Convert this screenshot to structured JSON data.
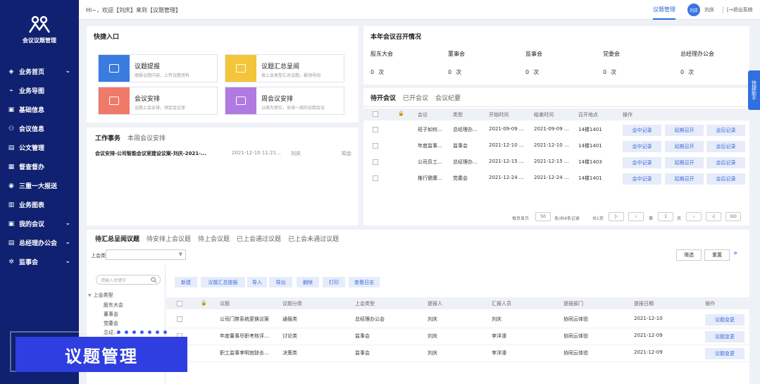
{
  "app": {
    "name": "会议议题管理"
  },
  "sidebar": {
    "items": [
      {
        "label": "业务首页",
        "icon": "home-icon",
        "chev": true
      },
      {
        "label": "业务导图",
        "icon": "map-icon",
        "chev": false
      },
      {
        "label": "基础信息",
        "icon": "info-icon",
        "chev": false
      },
      {
        "label": "会议信息",
        "icon": "people-icon",
        "chev": false
      },
      {
        "label": "公文管理",
        "icon": "document-icon",
        "chev": false
      },
      {
        "label": "督查督办",
        "icon": "supervise-icon",
        "chev": false
      },
      {
        "label": "三重一大报送",
        "icon": "report-icon",
        "chev": false
      },
      {
        "label": "业务图表",
        "icon": "chart-icon",
        "chev": false
      },
      {
        "label": "我的会议",
        "icon": "meeting-icon",
        "chev": true
      },
      {
        "label": "总经理办公会",
        "icon": "office-icon",
        "chev": true
      },
      {
        "label": "监事会",
        "icon": "board-icon",
        "chev": true
      }
    ]
  },
  "topbar": {
    "greeting": "Hi~，欢迎【刘庆】来到【议题管理】",
    "active_tab": "议题管理",
    "avatar": "刘庆",
    "user": "刘庆",
    "logout": "[→退出系统"
  },
  "quick_entry": {
    "title": "快捷入口",
    "cards": [
      {
        "title": "议题提报",
        "sub": "填报议题内容，上传议题资料",
        "color": "#3a7be0",
        "icon": "image-icon"
      },
      {
        "title": "议题汇总呈阅",
        "sub": "按上会类型汇总议题，报领导阅",
        "color": "#f3c53a",
        "icon": "docs-icon"
      },
      {
        "title": "会议安排",
        "sub": "议题上会安排，预定会议室",
        "color": "#f07a6a",
        "icon": "calendar-icon"
      },
      {
        "title": "周会议安排",
        "sub": "以周为单位，安排一周的议题会议",
        "color": "#b07ae0",
        "icon": "group-icon"
      }
    ]
  },
  "meeting_stats": {
    "title": "本年会议召开情况",
    "items": [
      {
        "label": "股东大会",
        "count": "0",
        "unit": "次"
      },
      {
        "label": "董事会",
        "count": "0",
        "unit": "次"
      },
      {
        "label": "监事会",
        "count": "0",
        "unit": "次"
      },
      {
        "label": "党委会",
        "count": "0",
        "unit": "次"
      },
      {
        "label": "总经理办公会",
        "count": "0",
        "unit": "次"
      }
    ]
  },
  "work": {
    "tabs": [
      "工作事务",
      "本周会议安排"
    ],
    "rows": [
      {
        "title": "会议安排-公司智能会议室建设议案-刘庆-2021-...",
        "time": "2021-12-10 11:21...",
        "user": "刘庆",
        "status": "知会"
      }
    ]
  },
  "pending": {
    "tabs": [
      "待开会议",
      "已开会议",
      "会议纪要"
    ],
    "headers": [
      "会议",
      "类型",
      "开始时间",
      "结束时间",
      "召开地点",
      "操作"
    ],
    "actions": [
      "会中记录",
      "延期召开",
      "会后记录"
    ],
    "rows": [
      {
        "name": "班子如何...",
        "type": "总经理办...",
        "start": "2021-09-09 ...",
        "end": "2021-09-09 ...",
        "place": "14楼1401"
      },
      {
        "name": "年度监事...",
        "type": "监事会",
        "start": "2021-12-10 ...",
        "end": "2021-12-10 ...",
        "place": "14楼1401"
      },
      {
        "name": "公司员工...",
        "type": "总经理办...",
        "start": "2021-12-15 ...",
        "end": "2021-12-15 ...",
        "place": "14楼1403"
      },
      {
        "name": "推行健康...",
        "type": "党委会",
        "start": "2021-12-24 ...",
        "end": "2021-12-24 ...",
        "place": "14楼1401"
      }
    ],
    "pager": {
      "per_page_label": "每页显示",
      "per_page": "50",
      "total": "条/共4条记录",
      "pages": "共1页",
      "page_label": "第",
      "page": "1",
      "page_unit": "页",
      "go": "GO"
    }
  },
  "topics": {
    "tabs": [
      "待汇总呈阅议题",
      "待安排上会议题",
      "待上会议题",
      "已上会通过议题",
      "已上会未通过议题"
    ],
    "filter_label": "上会类型",
    "filter_btn": "筛选",
    "reset_btn": "重置",
    "search_placeholder": "请输入关键字",
    "tree": {
      "root": "上会类型",
      "children": [
        "股东大会",
        "董事会",
        "党委会",
        "总经..."
      ]
    },
    "toolbar": [
      "新建",
      "议题汇总提报",
      "导入",
      "导出",
      "删除",
      "打印",
      "查看日志"
    ],
    "headers": [
      "议题",
      "议题分类",
      "上会类型",
      "提报人",
      "汇报人员",
      "提报部门",
      "提报日期",
      "操作"
    ],
    "action": "议题变更",
    "rows": [
      {
        "title": "公司门禁系统更换议案",
        "cat": "通报类",
        "type": "总经理办公会",
        "by": "刘庆",
        "reporter": "刘庆",
        "dept": "协同云体验",
        "date": "2021-12-10"
      },
      {
        "title": "年度董事尽职考核评...",
        "cat": "讨论类",
        "type": "监事会",
        "by": "刘庆",
        "reporter": "李洋濠",
        "dept": "协同云体验",
        "date": "2021-12-09"
      },
      {
        "title": "职工监事李明宫辞去...",
        "cat": "决策类",
        "type": "监事会",
        "by": "刘庆",
        "reporter": "李洋濠",
        "dept": "协同云体验",
        "date": "2021-12-09"
      }
    ]
  },
  "banner": {
    "text": "议题管理"
  },
  "side_tab": {
    "label": "快捷助手"
  }
}
